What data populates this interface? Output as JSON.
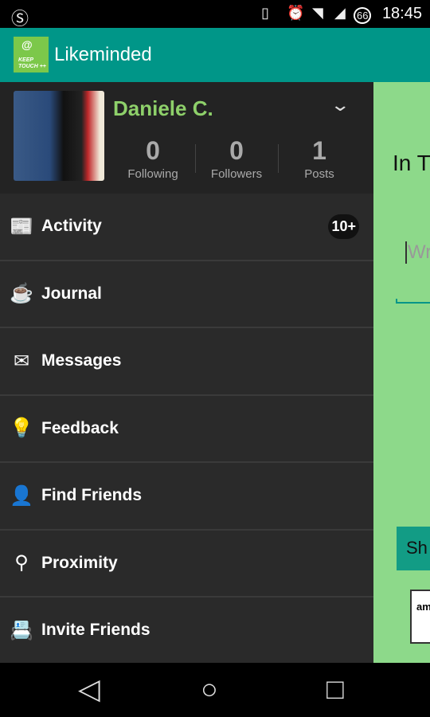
{
  "status": {
    "time": "18:45",
    "battery": "66"
  },
  "appbar": {
    "title": "Likeminded",
    "logo_text": "KEEP in TOUCH ++"
  },
  "profile": {
    "name": "Daniele C.",
    "stats": [
      {
        "value": "0",
        "label": "Following"
      },
      {
        "value": "0",
        "label": "Followers"
      },
      {
        "value": "1",
        "label": "Posts"
      }
    ]
  },
  "menu": [
    {
      "label": "Activity",
      "icon": "newspaper-icon",
      "badge": "10+"
    },
    {
      "label": "Journal",
      "icon": "coffee-icon"
    },
    {
      "label": "Messages",
      "icon": "envelope-icon"
    },
    {
      "label": "Feedback",
      "icon": "lightbulb-icon"
    },
    {
      "label": "Find Friends",
      "icon": "add-user-icon"
    },
    {
      "label": "Proximity",
      "icon": "location-pin-icon"
    },
    {
      "label": "Invite Friends",
      "icon": "contacts-icon"
    }
  ],
  "main": {
    "title": "In T",
    "input_placeholder": "Wr",
    "button": "Sh",
    "ad": "am"
  },
  "colors": {
    "appbar": "#009688",
    "drawer": "#2a2a2a",
    "name": "#8ed06a",
    "main_bg": "#8dd98a"
  }
}
